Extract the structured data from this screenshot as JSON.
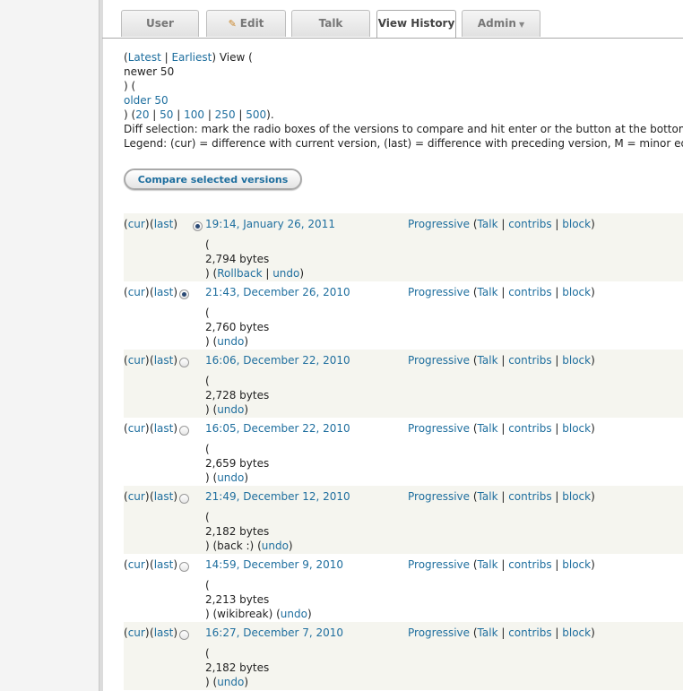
{
  "tabs": {
    "user": "User",
    "edit": "Edit",
    "talk": "Talk",
    "history": "View History",
    "admin": "Admin"
  },
  "intro": {
    "latest": "Latest",
    "earliest": "Earliest",
    "view_label": "View (",
    "newer": "newer 50",
    "close_open": ") (",
    "older": "older 50",
    "limits": [
      "20",
      "50",
      "100",
      "250",
      "500"
    ],
    "diff_text": "Diff selection: mark the radio boxes of the versions to compare and hit enter or the button at the bottom.",
    "legend_text": "Legend: (cur) = difference with current version, (last) = difference with preceding version, M = minor edit."
  },
  "compare_button": "Compare selected versions",
  "labels": {
    "cur": "cur",
    "last": "last",
    "talk": "Talk",
    "contribs": "contribs",
    "block": "block",
    "undo": "undo",
    "rollback": "Rollback"
  },
  "revisions": [
    {
      "date": "19:14, January 26, 2011",
      "user": "Progressive",
      "size": "2,794 bytes",
      "comment": "",
      "rollback": true,
      "checked": true
    },
    {
      "date": "21:43, December 26, 2010",
      "user": "Progressive",
      "size": "2,760 bytes",
      "comment": "",
      "rollback": false,
      "checked": true
    },
    {
      "date": "16:06, December 22, 2010",
      "user": "Progressive",
      "size": "2,728 bytes",
      "comment": "",
      "rollback": false,
      "checked": false
    },
    {
      "date": "16:05, December 22, 2010",
      "user": "Progressive",
      "size": "2,659 bytes",
      "comment": "",
      "rollback": false,
      "checked": false
    },
    {
      "date": "21:49, December 12, 2010",
      "user": "Progressive",
      "size": "2,182 bytes",
      "comment": "(back :)",
      "rollback": false,
      "checked": false
    },
    {
      "date": "14:59, December 9, 2010",
      "user": "Progressive",
      "size": "2,213 bytes",
      "comment": "(wikibreak)",
      "rollback": false,
      "checked": false
    },
    {
      "date": "16:27, December 7, 2010",
      "user": "Progressive",
      "size": "2,182 bytes",
      "comment": "",
      "rollback": false,
      "checked": false
    }
  ]
}
